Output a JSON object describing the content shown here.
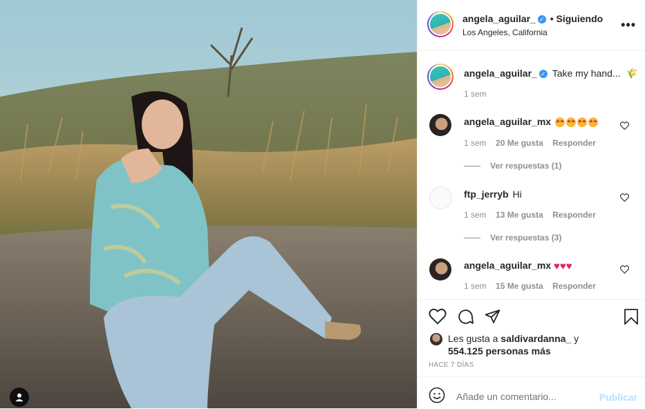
{
  "post": {
    "username": "angela_aguilar_",
    "follow_status": "• Siguiendo",
    "location": "Los Angeles, California",
    "more_icon": "more-options-icon"
  },
  "caption": {
    "username": "angela_aguilar_",
    "text": "Take my hand...",
    "time": "1 sem"
  },
  "comments": [
    {
      "username": "angela_aguilar_mx",
      "text": "",
      "emoji": "star-struck-emoji x4",
      "time": "1 sem",
      "likes": "20 Me gusta",
      "reply": "Responder",
      "view_replies": "Ver respuestas (1)"
    },
    {
      "username": "ftp_jerryb",
      "text": "Hi",
      "time": "1 sem",
      "likes": "13 Me gusta",
      "reply": "Responder",
      "view_replies": "Ver respuestas (3)"
    },
    {
      "username": "angela_aguilar_mx",
      "text": "",
      "emoji": "red-heart-emoji x3",
      "time": "1 sem",
      "likes": "15 Me gusta",
      "reply": "Responder"
    }
  ],
  "likes": {
    "prefix": "Les gusta a",
    "user": "saldivardanna_",
    "and": "y",
    "count": "554.125 personas más"
  },
  "timestamp": "HACE 7 DÍAS",
  "comment_input": {
    "placeholder": "Añade un comentario...",
    "publish": "Publicar"
  },
  "colors": {
    "accent": "#3897f0",
    "publish_disabled": "#b2dffc",
    "muted": "#8e8e8e"
  }
}
